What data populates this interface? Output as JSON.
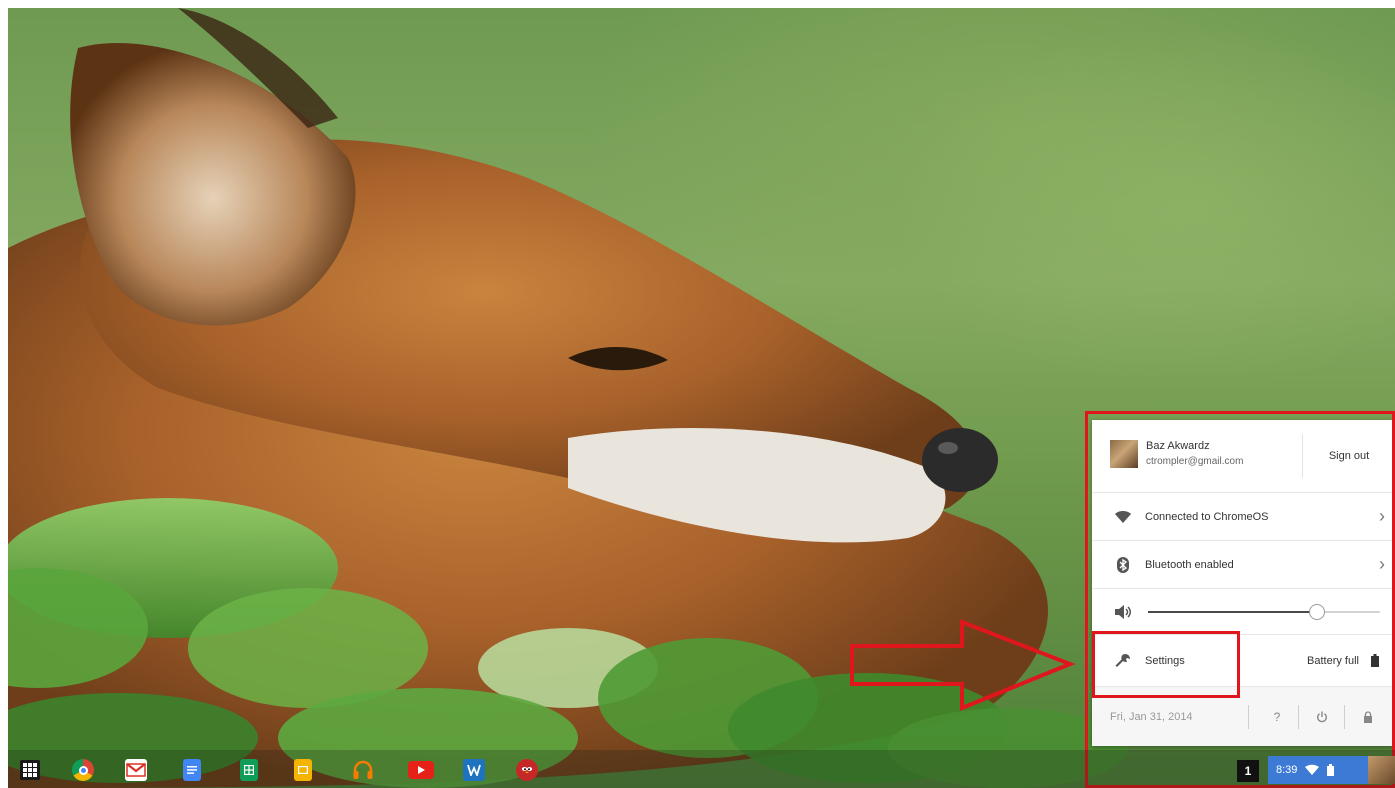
{
  "user": {
    "name": "Baz Akwardz",
    "email": "ctrompler@gmail.com",
    "sign_out_label": "Sign out"
  },
  "network": {
    "label": "Connected to ChromeOS",
    "icon": "wifi-icon"
  },
  "bluetooth": {
    "label": "Bluetooth enabled",
    "icon": "bluetooth-icon"
  },
  "volume": {
    "icon": "speaker-icon",
    "level_percent": 73
  },
  "settings": {
    "label": "Settings",
    "icon": "wrench-icon"
  },
  "battery": {
    "label": "Battery full",
    "icon": "battery-icon"
  },
  "footer": {
    "date": "Fri, Jan 31, 2014",
    "help_label": "?",
    "power_icon": "power-icon",
    "lock_icon": "lock-icon"
  },
  "shelf": {
    "apps": [
      {
        "name": "launcher",
        "icon": "app-launcher-icon"
      },
      {
        "name": "chrome",
        "icon": "chrome-icon",
        "color": "#dd4b39"
      },
      {
        "name": "gmail",
        "icon": "gmail-icon",
        "color": "#d93025"
      },
      {
        "name": "docs",
        "icon": "docs-icon",
        "color": "#4285f4"
      },
      {
        "name": "sheets",
        "icon": "sheets-icon",
        "color": "#0f9d58"
      },
      {
        "name": "slides",
        "icon": "slides-icon",
        "color": "#f4b400"
      },
      {
        "name": "music",
        "icon": "headphones-icon",
        "color": "#f57c00"
      },
      {
        "name": "youtube",
        "icon": "youtube-icon",
        "color": "#e62117"
      },
      {
        "name": "app-blue",
        "icon": "blue-app-icon",
        "color": "#1e73be"
      },
      {
        "name": "angry-birds",
        "icon": "angry-birds-icon",
        "color": "#c62828"
      }
    ],
    "workspace_badge": "1",
    "clock": "8:39"
  },
  "colors": {
    "highlight": "#e0161d",
    "status_area": "#3d7ad6"
  }
}
